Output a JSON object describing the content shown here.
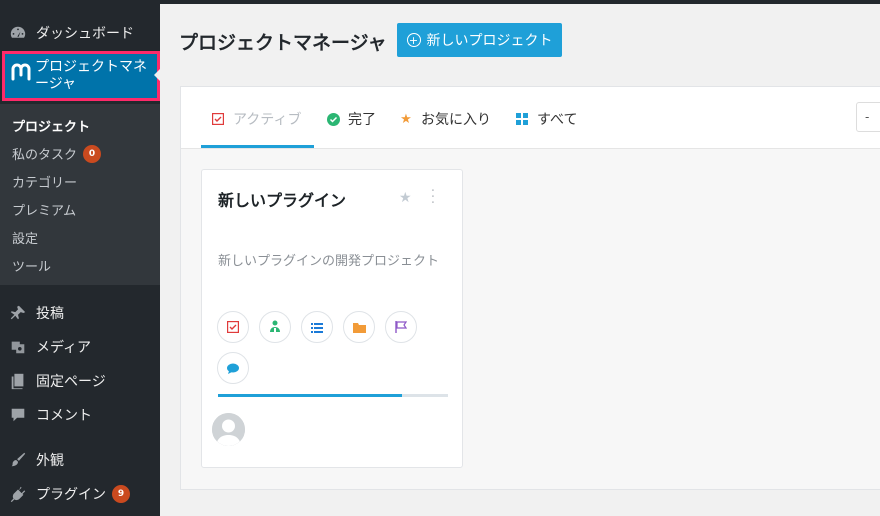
{
  "sidebar": {
    "dashboard": "ダッシュボード",
    "project_manager": "プロジェクトマネージャ",
    "submenu": {
      "projects": "プロジェクト",
      "my_tasks": "私のタスク",
      "my_tasks_count": "0",
      "categories": "カテゴリー",
      "premium": "プレミアム",
      "settings": "設定",
      "tools": "ツール"
    },
    "posts": "投稿",
    "media": "メディア",
    "pages": "固定ページ",
    "comments": "コメント",
    "appearance": "外観",
    "plugins": "プラグイン",
    "plugins_count": "9"
  },
  "header": {
    "title": "プロジェクトマネージャ",
    "new_project_button": "新しいプロジェクト"
  },
  "tabs": {
    "active": "アクティブ",
    "completed": "完了",
    "favourites": "お気に入り",
    "all": "すべて",
    "filter_partial": "- "
  },
  "project_card": {
    "title": "新しいプラグイン",
    "description": "新しいプラグインの開発プロジェクト",
    "progress_fraction": 0.8,
    "action_icons": [
      "task-list-icon",
      "users-icon",
      "list-icon",
      "folder-icon",
      "milestone-flag-icon",
      "discussion-icon"
    ]
  },
  "colors": {
    "accent": "#1fa0d8",
    "sidebar_bg": "#23282d",
    "active_menu": "#0073aa",
    "highlight_border": "#ff2a6a",
    "badge": "#ca4a1f"
  }
}
